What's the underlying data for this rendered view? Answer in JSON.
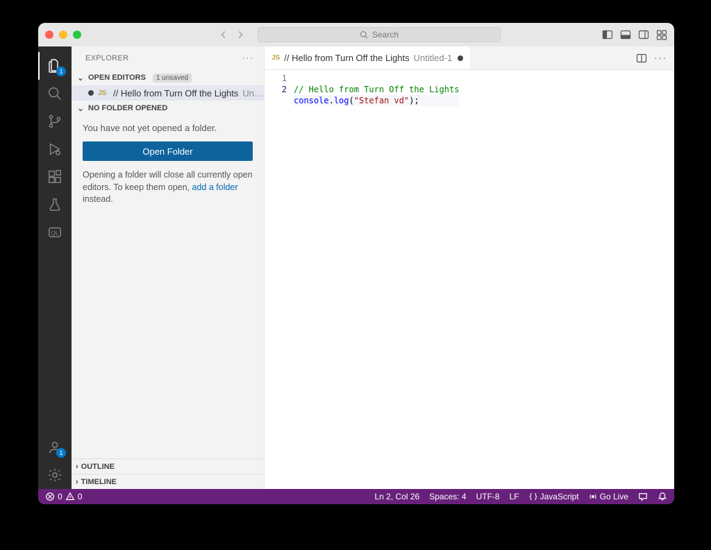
{
  "titlebar": {
    "search_placeholder": "Search"
  },
  "activitybar": {
    "explorer_badge": "1",
    "account_badge": "1"
  },
  "sidebar": {
    "title": "EXPLORER",
    "open_editors_label": "OPEN EDITORS",
    "unsaved_badge": "1 unsaved",
    "open_editor": {
      "filename": "// Hello from Turn Off the Lights",
      "subtitle": "Untitle..."
    },
    "no_folder_label": "NO FOLDER OPENED",
    "no_folder_text": "You have not yet opened a folder.",
    "open_folder_button": "Open Folder",
    "helper_prefix": "Opening a folder will close all currently open editors. To keep them open, ",
    "helper_link": "add a folder",
    "helper_suffix": " instead.",
    "outline_label": "OUTLINE",
    "timeline_label": "TIMELINE"
  },
  "tab": {
    "name": "// Hello from Turn Off the Lights",
    "subtitle": "Untitled-1"
  },
  "editor": {
    "lines": {
      "n1": "1",
      "n2": "2"
    },
    "line1": "// Hello from Turn Off the Lights",
    "line2_ident": "console",
    "line2_func": "log",
    "line2_str": "\"Stefan vd\""
  },
  "status": {
    "errors": "0",
    "warnings": "0",
    "cursor": "Ln 2, Col 26",
    "spaces": "Spaces: 4",
    "encoding": "UTF-8",
    "eol": "LF",
    "lang": "JavaScript",
    "golive": "Go Live"
  }
}
